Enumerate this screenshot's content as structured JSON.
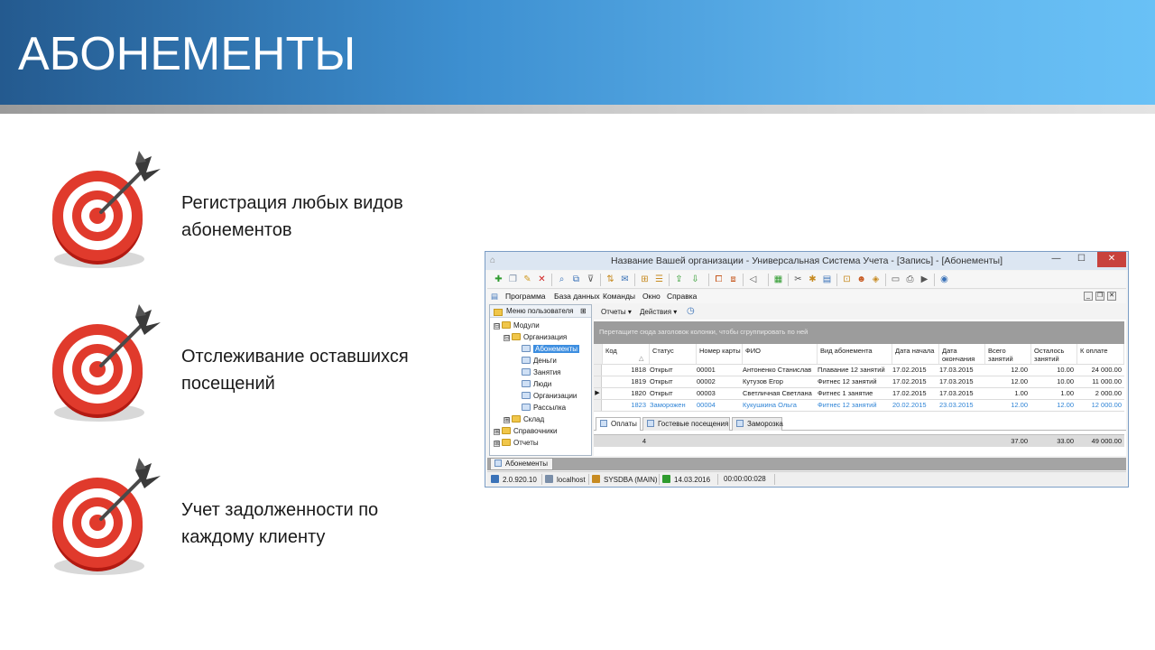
{
  "slide": {
    "title": "АБОНЕМЕНТЫ",
    "bullets": [
      {
        "text": "Регистрация любых видов\nабонементов",
        "icon": "target-icon"
      },
      {
        "text": "Отслеживание оставшихся\nпосещений",
        "icon": "target-icon"
      },
      {
        "text": "Учет задолженности по\nкаждому клиенту",
        "icon": "target-icon"
      }
    ]
  },
  "window": {
    "title": "Название Вашей организации - Универсальная Система Учета - [Запись] - [Абонементы]",
    "minimize": "—",
    "maximize": "☐",
    "close": "✕"
  },
  "menu": {
    "items": [
      "Программа",
      "База данных",
      "Команды",
      "Окно",
      "Справка"
    ]
  },
  "left_panel": {
    "title": "Меню пользователя",
    "pin": "⊞",
    "tree": [
      {
        "label": "Модули",
        "type": "folder",
        "level": 0,
        "expander": "⊟"
      },
      {
        "label": "Организация",
        "type": "folder",
        "level": 1,
        "expander": "⊟"
      },
      {
        "label": "Абонементы",
        "type": "doc",
        "level": 2,
        "selected": true
      },
      {
        "label": "Деньги",
        "type": "doc",
        "level": 2
      },
      {
        "label": "Занятия",
        "type": "doc",
        "level": 2
      },
      {
        "label": "Люди",
        "type": "doc",
        "level": 2
      },
      {
        "label": "Организации",
        "type": "doc",
        "level": 2
      },
      {
        "label": "Рассылка",
        "type": "doc",
        "level": 2
      },
      {
        "label": "Склад",
        "type": "folder",
        "level": 1,
        "expander": "⊞"
      },
      {
        "label": "Справочники",
        "type": "folder",
        "level": 0,
        "expander": "⊞"
      },
      {
        "label": "Отчеты",
        "type": "folder",
        "level": 0,
        "expander": "⊞"
      }
    ]
  },
  "right_toolbar": {
    "reports": "Отчеты ▾",
    "actions": "Действия ▾"
  },
  "grid": {
    "group_hint": "Перетащите сюда заголовок колонки, чтобы сгруппировать по ней",
    "columns": [
      "Код",
      "Статус",
      "Номер карты",
      "ФИО",
      "Вид абонемента",
      "Дата начала",
      "Дата окончания",
      "Всего занятий",
      "Осталось занятий",
      "К оплате"
    ],
    "rows": [
      [
        "1818",
        "Открыт",
        "00001",
        "Антоненко Станислав",
        "Плавание 12 занятий",
        "17.02.2015",
        "17.03.2015",
        "12.00",
        "10.00",
        "24 000.00"
      ],
      [
        "1819",
        "Открыт",
        "00002",
        "Кутузов Егор",
        "Фитнес 12 занятий",
        "17.02.2015",
        "17.03.2015",
        "12.00",
        "10.00",
        "11 000.00"
      ],
      [
        "1820",
        "Открыт",
        "00003",
        "Светличная Светлана",
        "Фитнес 1 занятие",
        "17.02.2015",
        "17.03.2015",
        "1.00",
        "1.00",
        "2 000.00"
      ],
      [
        "1823",
        "Заморожен",
        "00004",
        "Кукушкина Ольга",
        "Фитнес 12 занятий",
        "20.02.2015",
        "23.03.2015",
        "12.00",
        "12.00",
        "12 000.00"
      ]
    ],
    "current_row_marker": "▶",
    "footer": {
      "count": "4",
      "total_lessons": "37.00",
      "remaining_lessons": "33.00",
      "to_pay": "49 000.00"
    }
  },
  "detail_tabs": [
    "Оплаты",
    "Гостевые посещения",
    "Заморозка"
  ],
  "doc_tab": "Абонементы",
  "status_bar": {
    "version": "2.0.920.10",
    "host": "localhost",
    "user": "SYSDBA (MAIN)",
    "date": "14.03.2016",
    "timer": "00:00:00:028"
  },
  "colors": {
    "header_start": "#245a8f",
    "header_end": "#69c1f6",
    "selection": "#3d8ee0",
    "frozen_row": "#2f84d6",
    "target_red": "#d8261c"
  }
}
